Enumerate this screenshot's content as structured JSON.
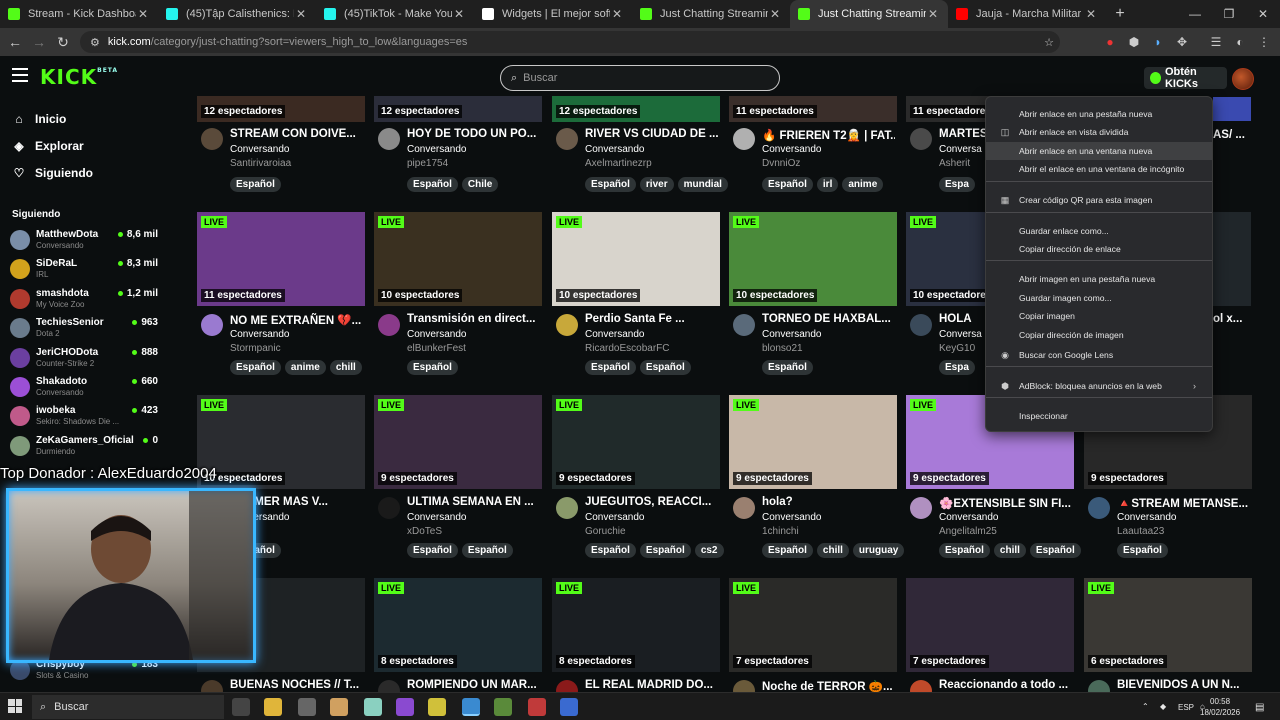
{
  "browser": {
    "tabs": [
      {
        "title": "Stream - Kick Dashboard",
        "color": "#53fc18"
      },
      {
        "title": "(45)Tập Calisthenics: Hướng Dẫ",
        "color": "#25f4ee"
      },
      {
        "title": "(45)TikTok - Make Your Day",
        "color": "#25f4ee"
      },
      {
        "title": "Widgets | El mejor software pa",
        "color": "#ffffff"
      },
      {
        "title": "Just Chatting Streaming - Live",
        "color": "#53fc18"
      },
      {
        "title": "Just Chatting Streaming - Live",
        "color": "#53fc18",
        "active": true
      },
      {
        "title": "Jauja - Marcha Militar - YouTub",
        "color": "#ff0000"
      }
    ],
    "url_host": "kick.com",
    "url_path": "/category/just-chatting?sort=viewers_high_to_low&languages=es"
  },
  "header": {
    "logo": "KICK",
    "logo_sup": "BETA",
    "search_placeholder": "Buscar",
    "obten": "Obtén KICKs"
  },
  "sidebar": {
    "nav": [
      {
        "label": "Inicio",
        "icon": "home-icon",
        "glyph": "⌂"
      },
      {
        "label": "Explorar",
        "icon": "compass-icon",
        "glyph": "◈"
      },
      {
        "label": "Siguiendo",
        "icon": "heart-icon",
        "glyph": "♡"
      }
    ],
    "following_title": "Siguiendo",
    "channels": [
      {
        "name": "MatthewDota",
        "category": "Conversando",
        "viewers": "8,6 mil",
        "color": "#7a8ea8"
      },
      {
        "name": "SiDeRaL",
        "category": "IRL",
        "viewers": "8,3 mil",
        "color": "#d2a21c"
      },
      {
        "name": "smashdota",
        "category": "My Voice Zoo",
        "viewers": "1,2 mil",
        "color": "#b03a2e"
      },
      {
        "name": "TechiesSenior",
        "category": "Dota 2",
        "viewers": "963",
        "color": "#6a7b8c"
      },
      {
        "name": "JeriCHODota",
        "category": "Counter-Strike 2",
        "viewers": "888",
        "color": "#6b3fa0"
      },
      {
        "name": "Shakadoto",
        "category": "Conversando",
        "viewers": "660",
        "color": "#9b4fd6"
      },
      {
        "name": "iwobeka",
        "category": "Sekiro: Shadows Die ...",
        "viewers": "423",
        "color": "#c05a8a"
      },
      {
        "name": "ZeKaGamers_Oficial",
        "category": "Durmiendo",
        "viewers": "0",
        "color": "#7f9a7a"
      },
      {
        "name": "Crispyboy",
        "category": "Slots & Casino",
        "viewers": "183",
        "color": "#3a4a6a"
      }
    ]
  },
  "cards": [
    {
      "viewers": "12 espectadores",
      "title": "STREAM CON DOIVE...",
      "category": "Conversando",
      "channel": "Santirivaroiaa",
      "tags": [
        "Español"
      ],
      "thumb": "#3b2a22",
      "avatar": "#5a4a3a",
      "live": false
    },
    {
      "viewers": "12 espectadores",
      "title": "HOY DE TODO UN PO...",
      "category": "Conversando",
      "channel": "pipe1754",
      "tags": [
        "Español",
        "Chile"
      ],
      "thumb": "#2b2d3a",
      "avatar": "#8a8a8a",
      "live": false
    },
    {
      "viewers": "12 espectadores",
      "title": "RIVER VS CIUDAD DE ...",
      "category": "Conversando",
      "channel": "Axelmartinezrp",
      "tags": [
        "Español",
        "river",
        "mundial"
      ],
      "thumb": "#1c6b3a",
      "avatar": "#6a5a4a",
      "live": false
    },
    {
      "viewers": "11 espectadores",
      "title": "🔥 FRIEREN T2🧝 | FAT...",
      "category": "Conversando",
      "channel": "DvnniOz",
      "tags": [
        "Español",
        "irl",
        "anime"
      ],
      "thumb": "#3a2e2a",
      "avatar": "#b0b0b0",
      "live": false
    },
    {
      "viewers": "11 espectadores",
      "title": "MARTES",
      "category": "Conversa",
      "channel": "Asherit",
      "tags": [
        "Espa"
      ],
      "thumb": "#2a2a2a",
      "avatar": "#4a4a4a",
      "live": false
    },
    {
      "viewers": "11 espectadores",
      "title": "NO ME EXTRAÑEN 💔...",
      "category": "Conversando",
      "channel": "Stormpanic",
      "tags": [
        "Español",
        "anime",
        "chill"
      ],
      "thumb": "#6b3a8a",
      "avatar": "#9a7ad0",
      "live": true
    },
    {
      "viewers": "10 espectadores",
      "title": "Transmisión en direct...",
      "category": "Conversando",
      "channel": "elBunkerFest",
      "tags": [
        "Español"
      ],
      "thumb": "#3a3020",
      "avatar": "#8a3a8a",
      "live": true
    },
    {
      "viewers": "10 espectadores",
      "title": "Perdio Santa Fe ...",
      "category": "Conversando",
      "channel": "RicardoEscobarFC",
      "tags": [
        "Español",
        "Español"
      ],
      "thumb": "#d8d4cc",
      "avatar": "#c8a83a",
      "live": true
    },
    {
      "viewers": "10 espectadores",
      "title": "TORNEO DE HAXBAL...",
      "category": "Conversando",
      "channel": "blonso21",
      "tags": [
        "Español"
      ],
      "thumb": "#4a8a3a",
      "avatar": "#5a6a7a",
      "live": true
    },
    {
      "viewers": "10 espectadores",
      "title": "HOLA",
      "category": "Conversa",
      "channel": "KeyG10",
      "tags": [
        "Espa"
      ],
      "thumb": "#2a3040",
      "avatar": "#3a4a5a",
      "live": true
    },
    {
      "viewers": "10 espectadores",
      "title": "REAMER MÁS V...",
      "category": "Conversando",
      "channel": "z",
      "tags": [
        "Español"
      ],
      "thumb": "#2a2c30",
      "avatar": "#4a4a4a",
      "live": true
    },
    {
      "viewers": "9 espectadores",
      "title": "ÚLTIMA SEMANA EN ...",
      "category": "Conversando",
      "channel": "xDoTeS",
      "tags": [
        "Español",
        "Español"
      ],
      "thumb": "#3a2a40",
      "avatar": "#1a1a1a",
      "live": true
    },
    {
      "viewers": "9 espectadores",
      "title": "JUEGUITOS, REACCI...",
      "category": "Conversando",
      "channel": "Goruchie",
      "tags": [
        "Español",
        "Español",
        "cs2"
      ],
      "thumb": "#202a2a",
      "avatar": "#8a9a6a",
      "live": true
    },
    {
      "viewers": "9 espectadores",
      "title": "hola?",
      "category": "Conversando",
      "channel": "1chinchi",
      "tags": [
        "Español",
        "chill",
        "uruguay"
      ],
      "thumb": "#c8b8a8",
      "avatar": "#9a8070",
      "live": true
    },
    {
      "viewers": "9 espectadores",
      "title": "🌸EXTENSIBLE SIN FI...",
      "category": "Conversando",
      "channel": "Angelitalm25",
      "tags": [
        "Español",
        "chill",
        "Español"
      ],
      "thumb": "#a87ad8",
      "avatar": "#b090c0",
      "live": true
    },
    {
      "viewers": "9 espectadores",
      "title": "🔺STREAM METANSE...",
      "category": "Conversando",
      "channel": "Laautaa23",
      "tags": [
        "Español"
      ],
      "thumb": "#282828",
      "avatar": "#3a5a7a",
      "live": true
    },
    {
      "viewers": "",
      "title": "BUENAS NOCHES // T...",
      "category": "",
      "channel": "",
      "tags": [],
      "thumb": "#1e2224",
      "avatar": "#4a3a2a",
      "live": false
    },
    {
      "viewers": "8 espectadores",
      "title": "ROMPIENDO UN MAR...",
      "category": "",
      "channel": "",
      "tags": [],
      "thumb": "#1c2a30",
      "avatar": "#2a2a2a",
      "live": true
    },
    {
      "viewers": "8 espectadores",
      "title": "EL REAL MADRID DO...",
      "category": "",
      "channel": "",
      "tags": [],
      "thumb": "#1a1e22",
      "avatar": "#8a1a1a",
      "live": true
    },
    {
      "viewers": "7 espectadores",
      "title": "Noche de TERROR 🎃...",
      "category": "",
      "channel": "",
      "tags": [],
      "thumb": "#2a2a28",
      "avatar": "#6a5a3a",
      "live": true
    },
    {
      "viewers": "7 espectadores",
      "title": "Reaccionando a todo ...",
      "category": "",
      "channel": "",
      "tags": [],
      "thumb": "#302838",
      "avatar": "#c04a2a",
      "live": false
    },
    {
      "viewers": "6 espectadores",
      "title": "BIEVENIDOS A UN N...",
      "category": "",
      "channel": "",
      "tags": [],
      "thumb": "#3a3834",
      "avatar": "#4a6a5a",
      "live": true
    }
  ],
  "partial_right": {
    "title_a": "AS/ ...",
    "title_b": "ol x..."
  },
  "context_menu": {
    "items": [
      {
        "label": "Abrir enlace en una pestaña nueva",
        "icon": ""
      },
      {
        "label": "Abrir enlace en vista dividida",
        "icon": "split-view-icon",
        "glyph": "◫"
      },
      {
        "label": "Abrir enlace en una ventana nueva",
        "icon": "",
        "highlight": true
      },
      {
        "label": "Abrir el enlace en una ventana de incógnito",
        "icon": ""
      },
      {
        "label": "Crear código QR para esta imagen",
        "icon": "qr-icon",
        "glyph": "▦"
      },
      {
        "label": "Guardar enlace como...",
        "icon": ""
      },
      {
        "label": "Copiar dirección de enlace",
        "icon": ""
      },
      {
        "label": "Abrir imagen en una pestaña nueva",
        "icon": ""
      },
      {
        "label": "Guardar imagen como...",
        "icon": ""
      },
      {
        "label": "Copiar imagen",
        "icon": ""
      },
      {
        "label": "Copiar dirección de imagen",
        "icon": ""
      },
      {
        "label": "Buscar con Google Lens",
        "icon": "lens-icon",
        "glyph": "◉"
      },
      {
        "label": "AdBlock: bloquea anuncios en la web",
        "icon": "adblock-icon",
        "glyph": "⬢",
        "submenu": true
      },
      {
        "label": "Inspeccionar",
        "icon": ""
      }
    ]
  },
  "overlay": {
    "donor": "Top Donador : AlexEduardo2004"
  },
  "taskbar": {
    "search": "Buscar",
    "lang": "ESP",
    "time": "00:58",
    "date": "18/02/2026"
  }
}
